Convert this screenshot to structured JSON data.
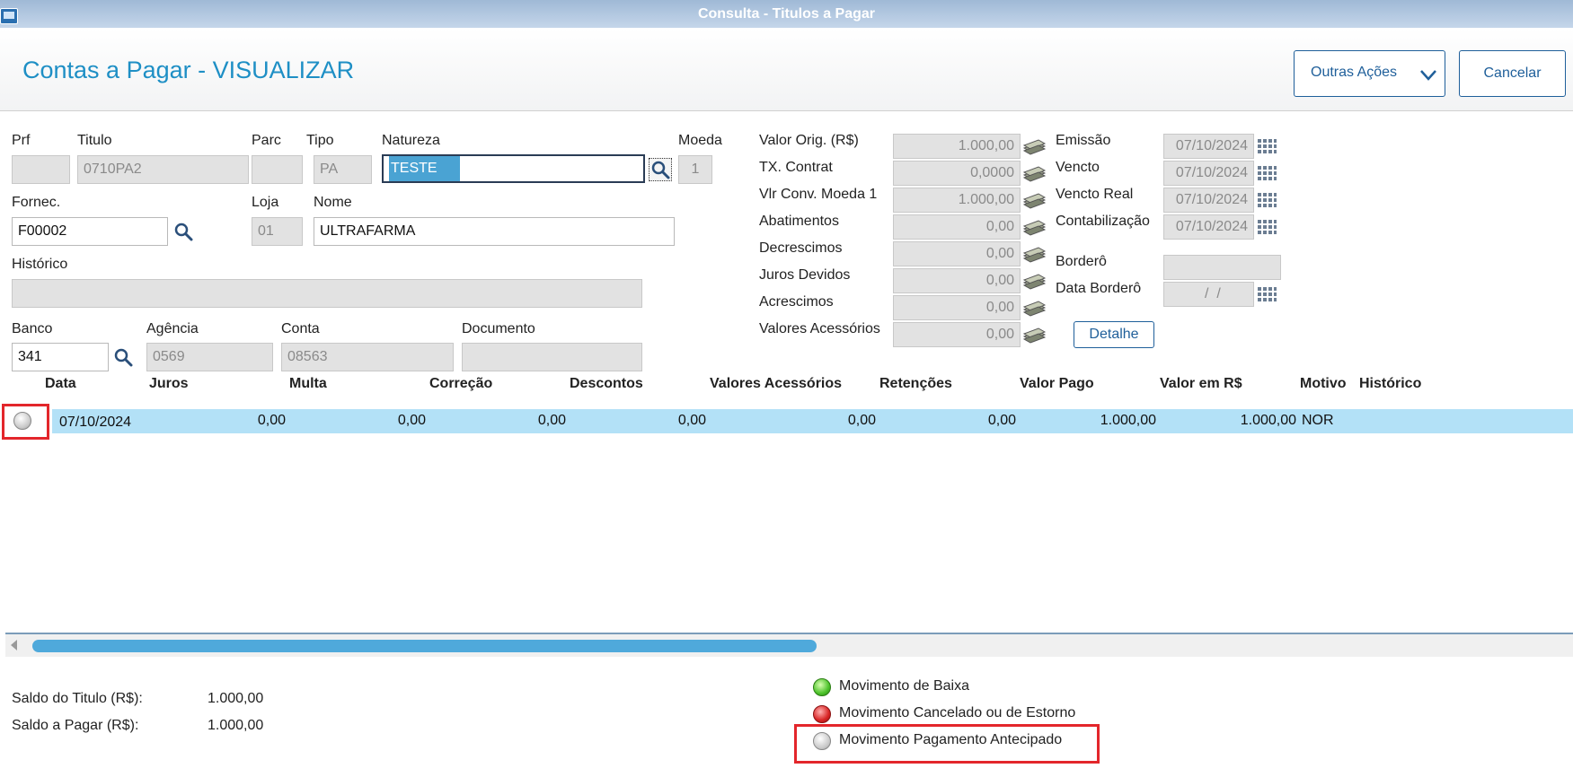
{
  "window": {
    "title": "Consulta - Titulos a Pagar"
  },
  "header": {
    "title": "Contas a Pagar - VISUALIZAR",
    "more_actions": "Outras Ações",
    "cancel": "Cancelar"
  },
  "form": {
    "prf": {
      "label": "Prf",
      "value": ""
    },
    "titulo": {
      "label": "Titulo",
      "value": "0710PA2"
    },
    "parc": {
      "label": "Parc",
      "value": ""
    },
    "tipo": {
      "label": "Tipo",
      "value": "PA"
    },
    "natureza": {
      "label": "Natureza",
      "value": "TESTE"
    },
    "moeda": {
      "label": "Moeda",
      "value": "1"
    },
    "fornec": {
      "label": "Fornec.",
      "value": "F00002"
    },
    "loja": {
      "label": "Loja",
      "value": "01"
    },
    "nome": {
      "label": "Nome",
      "value": "ULTRAFARMA"
    },
    "historico": {
      "label": "Histórico",
      "value": ""
    },
    "banco": {
      "label": "Banco",
      "value": "341"
    },
    "agencia": {
      "label": "Agência",
      "value": "0569"
    },
    "conta": {
      "label": "Conta",
      "value": "08563"
    },
    "documento": {
      "label": "Documento",
      "value": ""
    }
  },
  "values": [
    {
      "label": "Valor Orig. (R$)",
      "value": "1.000,00"
    },
    {
      "label": "TX. Contrat",
      "value": "0,0000"
    },
    {
      "label": "Vlr Conv. Moeda 1",
      "value": "1.000,00"
    },
    {
      "label": "Abatimentos",
      "value": "0,00"
    },
    {
      "label": "Decrescimos",
      "value": "0,00"
    },
    {
      "label": "Juros Devidos",
      "value": "0,00"
    },
    {
      "label": "Acrescimos",
      "value": "0,00"
    },
    {
      "label": "Valores Acessórios",
      "value": "0,00"
    }
  ],
  "dates": {
    "emissao": {
      "label": "Emissão",
      "value": "07/10/2024"
    },
    "vencto": {
      "label": "Vencto",
      "value": "07/10/2024"
    },
    "vencto_real": {
      "label": "Vencto Real",
      "value": "07/10/2024"
    },
    "contabilizacao": {
      "label": "Contabilização",
      "value": "07/10/2024"
    },
    "bordero": {
      "label": "Borderô",
      "value": ""
    },
    "data_bordero": {
      "label": "Data Borderô",
      "value": "  /  /"
    },
    "detalhe": "Detalhe"
  },
  "grid": {
    "columns": [
      "Data",
      "Juros",
      "Multa",
      "Correção",
      "Descontos",
      "Valores Acessórios",
      "Retenções",
      "Valor Pago",
      "Valor em R$",
      "Motivo",
      "Histórico"
    ],
    "row": [
      "07/10/2024",
      "0,00",
      "0,00",
      "0,00",
      "0,00",
      "0,00",
      "0,00",
      "1.000,00",
      "1.000,00",
      "NOR",
      ""
    ]
  },
  "footer": {
    "saldo_titulo_label": "Saldo do Titulo (R$):",
    "saldo_titulo_value": "1.000,00",
    "saldo_pagar_label": "Saldo a Pagar (R$):",
    "saldo_pagar_value": "1.000,00"
  },
  "legend": [
    {
      "label": "Movimento de Baixa",
      "color": "#4cc22a"
    },
    {
      "label": "Movimento Cancelado ou de Estorno",
      "color": "#d82424"
    },
    {
      "label": "Movimento Pagamento Antecipado",
      "color": "#c8c8c8"
    }
  ],
  "colors": {
    "accent": "#1e8fc5",
    "selected_row": "#b3e1f7",
    "highlight": "#e3262b"
  }
}
